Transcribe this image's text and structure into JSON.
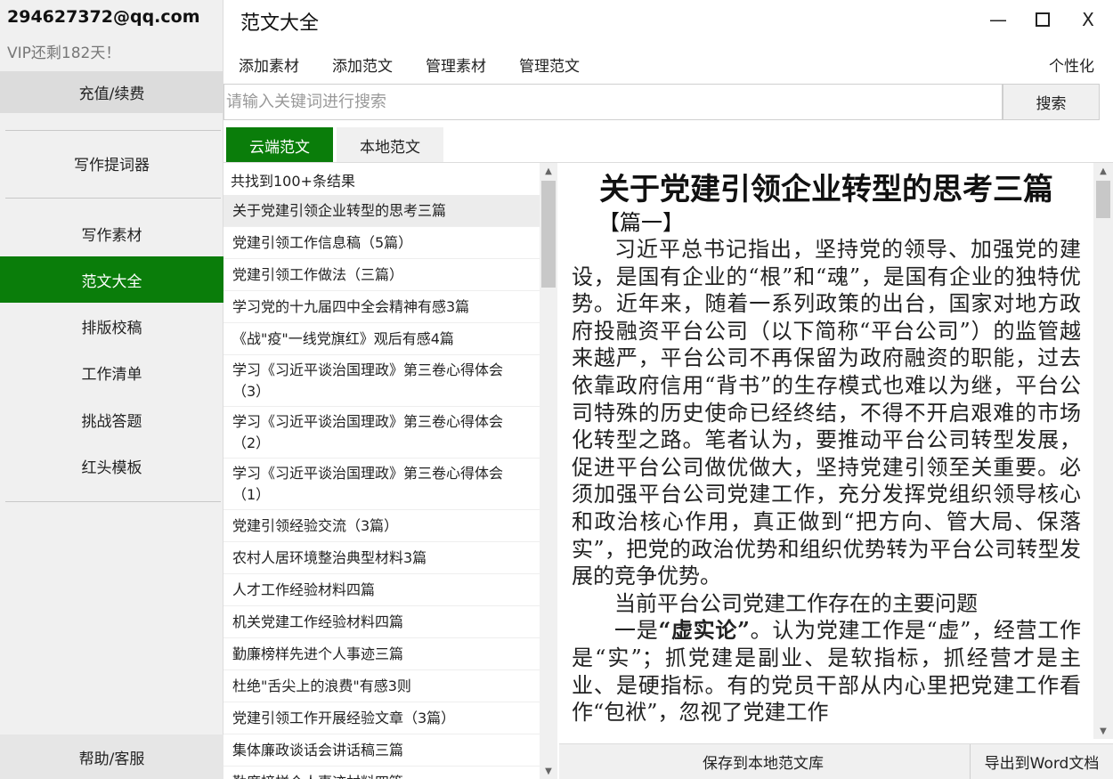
{
  "app": {
    "title": "范文大全"
  },
  "account": {
    "email": "294627372@qq.com",
    "vip_status": "VIP还剩182天！",
    "recharge_label": "充值/续费"
  },
  "sidebar": {
    "items": [
      {
        "label": "写作提词器"
      },
      {
        "label": "写作素材"
      },
      {
        "label": "范文大全",
        "active": true
      },
      {
        "label": "排版校稿"
      },
      {
        "label": "工作清单"
      },
      {
        "label": "挑战答题"
      },
      {
        "label": "红头模板"
      }
    ],
    "help_label": "帮助/客服"
  },
  "window_controls": {
    "minimize": "—",
    "close": "X"
  },
  "menu": {
    "items": [
      {
        "label": "添加素材"
      },
      {
        "label": "添加范文"
      },
      {
        "label": "管理素材"
      },
      {
        "label": "管理范文"
      }
    ],
    "personalize": "个性化"
  },
  "search": {
    "placeholder": "请输入关键词进行搜索",
    "value": "",
    "button_label": "搜索"
  },
  "tabs": [
    {
      "label": "云端范文",
      "active": true
    },
    {
      "label": "本地范文",
      "active": false
    }
  ],
  "results": {
    "count_text": "共找到100+条结果",
    "items": [
      {
        "title": "关于党建引领企业转型的思考三篇",
        "selected": true
      },
      {
        "title": "党建引领工作信息稿（5篇）"
      },
      {
        "title": "党建引领工作做法（三篇）"
      },
      {
        "title": "学习党的十九届四中全会精神有感3篇"
      },
      {
        "title": "《战\"疫\"一线党旗红》观后有感4篇"
      },
      {
        "title": "学习《习近平谈治国理政》第三卷心得体会（3）",
        "tall": true
      },
      {
        "title": "学习《习近平谈治国理政》第三卷心得体会（2）",
        "tall": true
      },
      {
        "title": "学习《习近平谈治国理政》第三卷心得体会（1）",
        "tall": true
      },
      {
        "title": "党建引领经验交流（3篇）"
      },
      {
        "title": "农村人居环境整治典型材料3篇"
      },
      {
        "title": "人才工作经验材料四篇"
      },
      {
        "title": "机关党建工作经验材料四篇"
      },
      {
        "title": "勤廉榜样先进个人事迹三篇"
      },
      {
        "title": "杜绝\"舌尖上的浪费\"有感3则"
      },
      {
        "title": "党建引领工作开展经验文章（3篇）"
      },
      {
        "title": "集体廉政谈话会讲话稿三篇"
      },
      {
        "title": "勤廉榜样个人事迹材料四篇"
      }
    ]
  },
  "article": {
    "title": "关于党建引领企业转型的思考三篇",
    "subtitle": "【篇一】",
    "para1": "习近平总书记指出，坚持党的领导、加强党的建设，是国有企业的“根”和“魂”，是国有企业的独特优势。近年来，随着一系列政策的出台，国家对地方政府投融资平台公司（以下简称“平台公司”）的监管越来越严，平台公司不再保留为政府融资的职能，过去依靠政府信用“背书”的生存模式也难以为继，平台公司特殊的历史使命已经终结，不得不开启艰难的市场化转型之路。笔者认为，要推动平台公司转型发展，促进平台公司做优做大，坚持党建引领至关重要。必须加强平台公司党建工作，充分发挥党组织领导核心和政治核心作用，真正做到“把方向、管大局、保落实”，把党的政治优势和组织优势转为平台公司转型发展的竞争优势。",
    "para2": "当前平台公司党建工作存在的主要问题",
    "para3_lead": "一是",
    "para3_bold": "“虚实论”",
    "para3_rest": "。认为党建工作是“虚”，经营工作是“实”；抓党建是副业、是软指标，抓经营才是主业、是硬指标。有的党员干部从内心里把党建工作看作“包袱”，忽视了党建工作"
  },
  "actions": {
    "save_label": "保存到本地范文库",
    "export_label": "导出到Word文档"
  }
}
